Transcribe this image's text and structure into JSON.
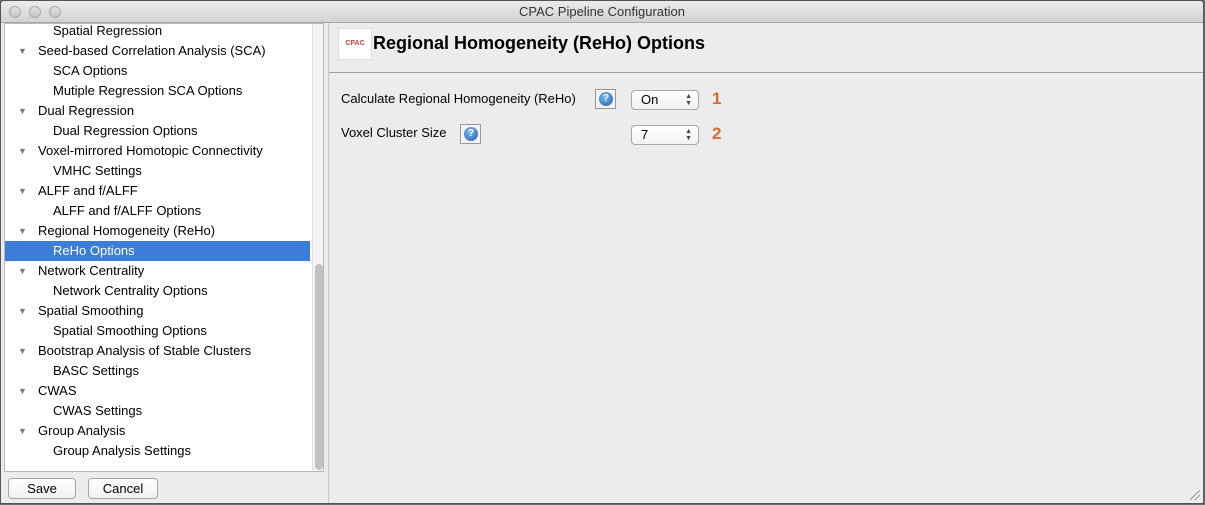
{
  "window": {
    "title": "CPAC Pipeline Configuration"
  },
  "tree": [
    {
      "label": "Spatial Regression",
      "level": 1
    },
    {
      "label": "Seed-based Correlation Analysis (SCA)",
      "level": 0
    },
    {
      "label": "SCA Options",
      "level": 1
    },
    {
      "label": "Mutiple Regression SCA Options",
      "level": 1
    },
    {
      "label": "Dual Regression",
      "level": 0
    },
    {
      "label": "Dual Regression Options",
      "level": 1
    },
    {
      "label": "Voxel-mirrored Homotopic Connectivity",
      "level": 0
    },
    {
      "label": "VMHC Settings",
      "level": 1
    },
    {
      "label": "ALFF and f/ALFF",
      "level": 0
    },
    {
      "label": "ALFF and f/ALFF Options",
      "level": 1
    },
    {
      "label": "Regional Homogeneity (ReHo)",
      "level": 0
    },
    {
      "label": "ReHo Options",
      "level": 1,
      "selected": true
    },
    {
      "label": "Network Centrality",
      "level": 0
    },
    {
      "label": "Network Centrality Options",
      "level": 1
    },
    {
      "label": "Spatial Smoothing",
      "level": 0
    },
    {
      "label": "Spatial Smoothing Options",
      "level": 1
    },
    {
      "label": "Bootstrap Analysis of Stable Clusters",
      "level": 0
    },
    {
      "label": "BASC Settings",
      "level": 1
    },
    {
      "label": "CWAS",
      "level": 0
    },
    {
      "label": "CWAS Settings",
      "level": 1
    },
    {
      "label": "Group Analysis",
      "level": 0
    },
    {
      "label": "Group Analysis Settings",
      "level": 1
    }
  ],
  "buttons": {
    "save": "Save",
    "cancel": "Cancel"
  },
  "panel": {
    "title": "Regional Homogeneity (ReHo) Options",
    "logo_text": "CPAC",
    "fields": [
      {
        "label": "Calculate Regional Homogeneity (ReHo)",
        "value": "On",
        "number": "1"
      },
      {
        "label": "Voxel Cluster Size",
        "value": "7",
        "number": "2"
      }
    ],
    "help_glyph": "?"
  },
  "colors": {
    "selection": "#3b7dd8",
    "annotation": "#e0662a"
  }
}
